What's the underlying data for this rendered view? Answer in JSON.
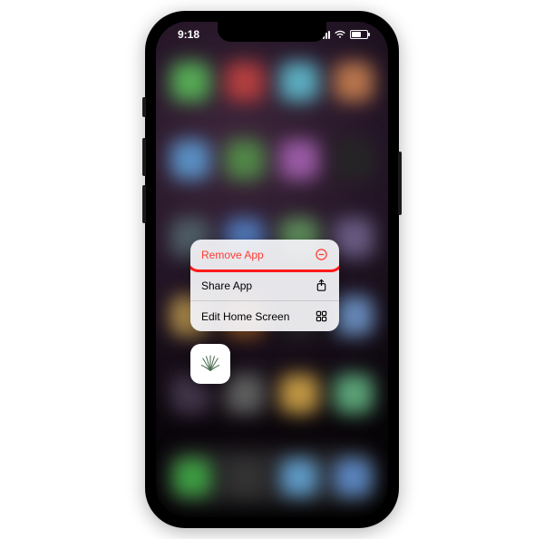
{
  "statusbar": {
    "time": "9:18"
  },
  "context_menu": {
    "items": [
      {
        "label": "Remove App",
        "icon": "remove-circle-icon",
        "destructive": true
      },
      {
        "label": "Share App",
        "icon": "share-icon",
        "destructive": false
      },
      {
        "label": "Edit Home Screen",
        "icon": "apps-icon",
        "destructive": false
      }
    ]
  },
  "blur_icons": [
    "#64c864",
    "#d24a4a",
    "#6ccbe1",
    "#d98a5a",
    "#6aa9e6",
    "#5fa055",
    "#b56bc2",
    "#2c2c2c",
    "#5d6f7a",
    "#5f8dd8",
    "#6ea56b",
    "#7a6b98",
    "#cfa75a",
    "#d27c2e",
    "#3a3a3a",
    "#7aa3db",
    "#4d3f57",
    "#6e6e6e",
    "#e0b050",
    "#6bbf8c"
  ],
  "dock_icons": [
    "#49b94f",
    "#3d3d3d",
    "#6fb4e8",
    "#6a9de0"
  ],
  "annotation": {
    "highlight_color": "#ff1a1a"
  }
}
